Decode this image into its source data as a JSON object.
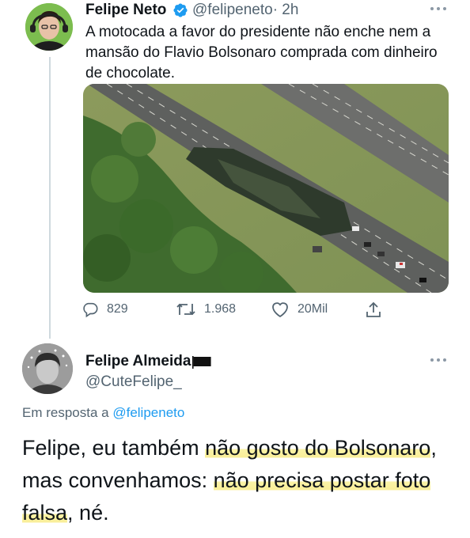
{
  "tweet": {
    "author_name": "Felipe Neto",
    "handle": "@felipeneto",
    "time": "· 2h",
    "text": "A motocada a favor do presidente não enche nem a mansão do Flavio Bolsonaro comprada com dinheiro de chocolate.",
    "image_description_icon": "aerial-photo",
    "actions": {
      "reply_count": "829",
      "retweet_count": "1.968",
      "like_count": "20Mil"
    }
  },
  "reply": {
    "author_name": "Felipe Almeida",
    "name_icon": "black-flag-icon",
    "handle": "@CuteFelipe_",
    "replying_prefix": "Em resposta a",
    "replying_to": "@felipeneto",
    "text_parts": [
      "Felipe, eu também ",
      "não gosto do Bolsonaro",
      ",",
      "mas convenhamos: ",
      "não precisa postar foto",
      "falsa",
      ", né."
    ]
  },
  "colors": {
    "text": "#0f1419",
    "secondary": "#536471",
    "link": "#1d9bf0",
    "verified": "#1d9bf0",
    "highlight": "#f9ee98"
  }
}
